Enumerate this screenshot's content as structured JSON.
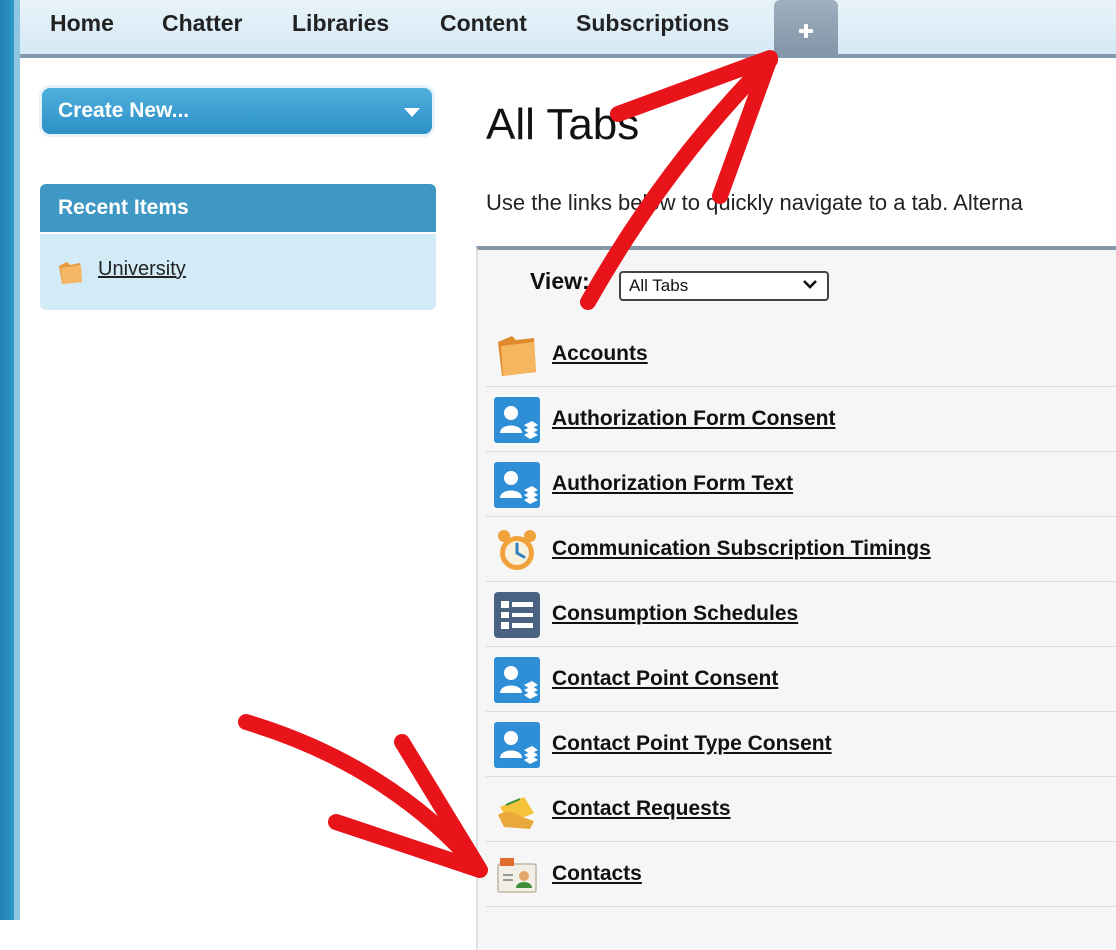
{
  "topnav": {
    "tabs": [
      {
        "label": "Home"
      },
      {
        "label": "Chatter"
      },
      {
        "label": "Libraries"
      },
      {
        "label": "Content"
      },
      {
        "label": "Subscriptions"
      }
    ]
  },
  "sidebar": {
    "create_new_label": "Create New...",
    "recent_items_title": "Recent Items",
    "recent_items": [
      {
        "label": "University",
        "icon": "folder-icon"
      }
    ]
  },
  "main": {
    "title": "All Tabs",
    "intro": "Use the links below to quickly navigate to a tab. Alterna",
    "view_label": "View:",
    "view_selected": "All Tabs",
    "tabs": [
      {
        "label": "Accounts",
        "icon": "folder-icon"
      },
      {
        "label": "Authorization Form Consent",
        "icon": "person-stack-icon"
      },
      {
        "label": "Authorization Form Text",
        "icon": "person-stack-icon"
      },
      {
        "label": "Communication Subscription Timings",
        "icon": "alarm-clock-icon"
      },
      {
        "label": "Consumption Schedules",
        "icon": "list-icon"
      },
      {
        "label": "Contact Point Consent",
        "icon": "person-stack-icon"
      },
      {
        "label": "Contact Point Type Consent",
        "icon": "person-stack-icon"
      },
      {
        "label": "Contact Requests",
        "icon": "hand-card-icon"
      },
      {
        "label": "Contacts",
        "icon": "contact-card-icon"
      }
    ]
  },
  "colors": {
    "nav_bg": "#d6e9f5",
    "accent_blue": "#2c90c7",
    "sidebar_panel": "#d3ebf6",
    "annotation_red": "#e8141a"
  }
}
